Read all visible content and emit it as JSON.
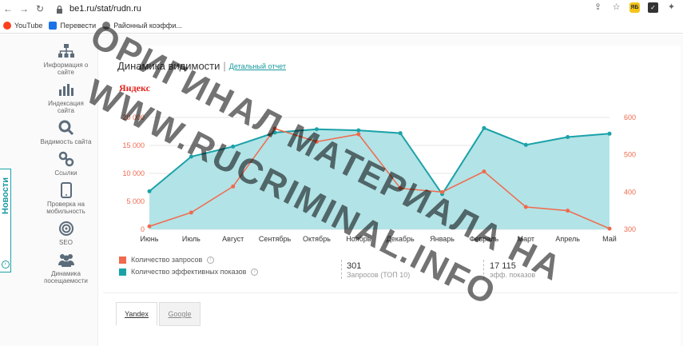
{
  "browser": {
    "url": "be1.ru/stat/rudn.ru",
    "bookmarks": [
      "YouTube",
      "Перевести",
      "Районный коэффи..."
    ]
  },
  "news": {
    "label": "Новости"
  },
  "sidebar": {
    "items": [
      {
        "label": "Информация о сайте",
        "icon": "sitemap-icon"
      },
      {
        "label": "Индексация сайта",
        "icon": "bar-chart-icon"
      },
      {
        "label": "Видимость сайта",
        "icon": "search-icon"
      },
      {
        "label": "Ссылки",
        "icon": "link-icon"
      },
      {
        "label": "Проверка на мобильность",
        "icon": "mobile-icon"
      },
      {
        "label": "SEO",
        "icon": "target-icon"
      },
      {
        "label": "Динамика посещаемости",
        "icon": "users-icon"
      }
    ]
  },
  "header": {
    "title": "Динамика видимости",
    "separator": "|",
    "link": "Детальный отчет"
  },
  "engine_logo": "Яндекс",
  "legend": {
    "queries": "Количество запросов",
    "impressions": "Количество эффективных показов",
    "info": "i"
  },
  "stats": [
    {
      "value": "301",
      "label": "Запросов (ТОП 10)"
    },
    {
      "value": "17 115",
      "label": "эфф. показов"
    }
  ],
  "tabs": [
    "Yandex",
    "Google"
  ],
  "watermark": [
    "ОРИГИНАЛ МАТЕРИАЛА НА",
    "WWW.RUCRIMINAL.INFO"
  ],
  "colors": {
    "teal": "#1aa2a8",
    "teal_fill": "#b2e3e6",
    "orange": "#f06a4d"
  },
  "chart_data": {
    "type": "line",
    "categories": [
      "Июнь",
      "Июль",
      "Август",
      "Сентябрь",
      "Октябрь",
      "Ноябрь",
      "Декабрь",
      "Январь",
      "Февраль",
      "Март",
      "Апрель",
      "Май"
    ],
    "series": [
      {
        "name": "Количество эффективных показов",
        "axis": "left",
        "style": "area",
        "values": [
          6800,
          13000,
          14800,
          17300,
          17900,
          17700,
          17200,
          6300,
          18100,
          15100,
          16500,
          17100
        ]
      },
      {
        "name": "Количество запросов",
        "axis": "right",
        "style": "line",
        "values": [
          308,
          345,
          415,
          570,
          535,
          555,
          410,
          400,
          455,
          360,
          350,
          302
        ]
      }
    ],
    "y_left": {
      "min": 0,
      "max": 20000,
      "ticks": [
        "0",
        "5 000",
        "10 000",
        "15 000",
        "20 000"
      ]
    },
    "y_right": {
      "min": 300,
      "max": 600,
      "ticks": [
        "300",
        "400",
        "500",
        "600"
      ]
    },
    "grid": true
  }
}
